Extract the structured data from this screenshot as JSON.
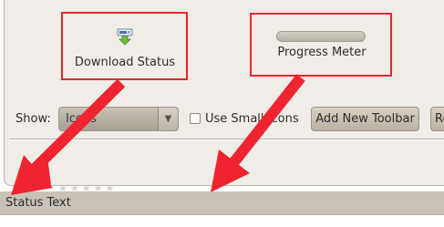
{
  "palette": {
    "download_status_label": "Download Status",
    "progress_meter_label": "Progress Meter"
  },
  "controls": {
    "show_label": "Show:",
    "show_value": "Icons",
    "use_small_icons_label": "Use Small Icons",
    "add_toolbar_label": "Add New Toolbar",
    "restore_label": "Re"
  },
  "statusbar": {
    "text": "Status Text"
  },
  "colors": {
    "highlight": "#e8262c",
    "arrow": "#ef2430"
  },
  "icons": {
    "download": "download-status-icon",
    "combo_arrow": "chevron-down-icon"
  }
}
